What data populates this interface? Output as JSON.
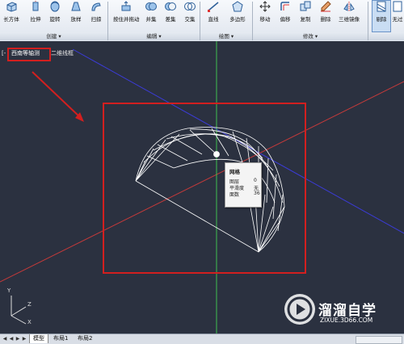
{
  "ribbon": {
    "tools": [
      {
        "label": "长方体",
        "icon": "box-icon"
      },
      {
        "label": "拉伸",
        "icon": "extrude-icon"
      },
      {
        "label": "旋转",
        "icon": "revolve-icon"
      },
      {
        "label": "放样",
        "icon": "loft-icon"
      },
      {
        "label": "扫掠",
        "icon": "sweep-icon"
      },
      {
        "label": "按住并拖动",
        "icon": "presspull-icon"
      },
      {
        "label": "并集",
        "icon": "union-icon"
      },
      {
        "label": "差集",
        "icon": "subtract-icon"
      },
      {
        "label": "交集",
        "icon": "intersect-icon"
      },
      {
        "label": "直线",
        "icon": "line-icon"
      },
      {
        "label": "多边形",
        "icon": "polygon-icon"
      },
      {
        "label": "移动",
        "icon": "move-icon"
      },
      {
        "label": "偏移",
        "icon": "offset-icon"
      },
      {
        "label": "复制",
        "icon": "copy-icon"
      },
      {
        "label": "删除",
        "icon": "erase-icon"
      },
      {
        "label": "三维镜像",
        "icon": "mirror3d-icon"
      },
      {
        "label": "剔除",
        "icon": "culling-icon"
      },
      {
        "label": "无过",
        "icon": "nofilter-icon"
      }
    ],
    "groups": [
      {
        "label": "创建 ▾"
      },
      {
        "label": "编辑 ▾"
      },
      {
        "label": "绘图 ▾"
      },
      {
        "label": "修改 ▾"
      }
    ]
  },
  "viewport": {
    "label_bracket": "[-",
    "view_name": "西南等轴测",
    "visual_style": "二维线框",
    "colors": {
      "background": "#2b3140",
      "annotation": "#d21f1f",
      "mesh": "#ffffff"
    }
  },
  "tooltip": {
    "title": "网格",
    "rows": [
      {
        "key": "图层",
        "value": "0"
      },
      {
        "key": "平滑度",
        "value": "无"
      },
      {
        "key": "面数",
        "value": "36"
      }
    ]
  },
  "ucs": {
    "x": "X",
    "y": "Y",
    "z": "Z"
  },
  "watermark": {
    "name": "溜溜自学",
    "url": "ZIXUE.3D66.COM"
  },
  "tabs": [
    {
      "label": "模型"
    },
    {
      "label": "布局1"
    },
    {
      "label": "布局2"
    }
  ],
  "nav_buttons": [
    "◀",
    "◀",
    "▶",
    "▶"
  ]
}
